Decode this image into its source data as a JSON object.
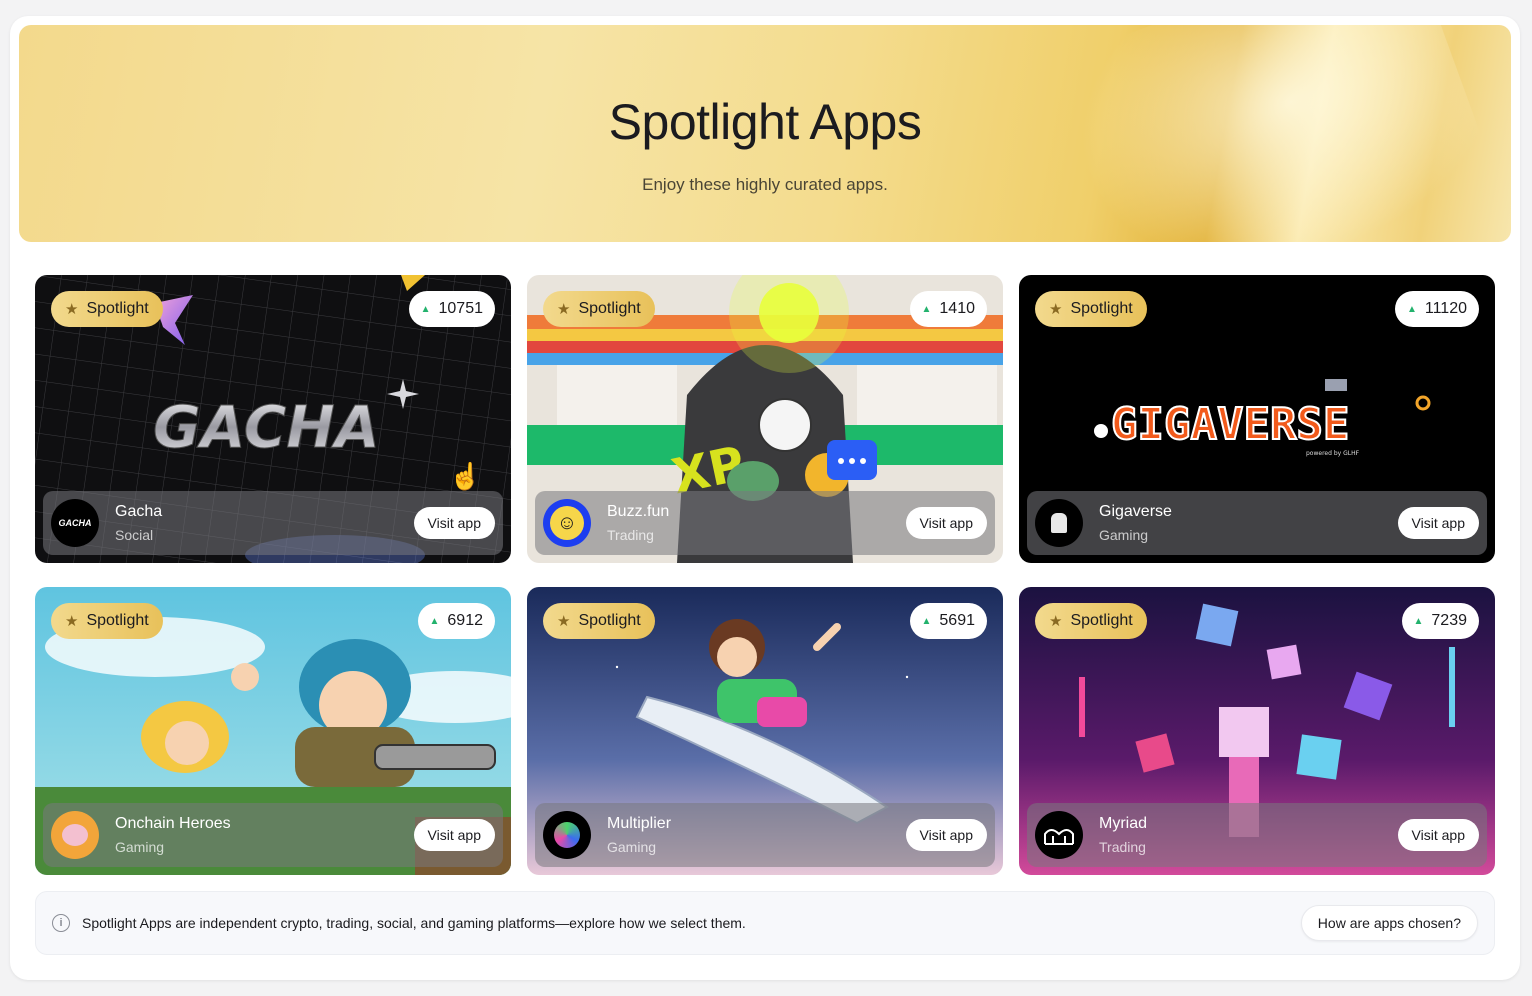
{
  "hero": {
    "title": "Spotlight Apps",
    "subtitle": "Enjoy these highly curated apps."
  },
  "cards": [
    {
      "badge": "Spotlight",
      "count": "10751",
      "name": "Gacha",
      "category": "Social",
      "visit": "Visit app",
      "art_text": "GACHA",
      "logo_text": "GACHA"
    },
    {
      "badge": "Spotlight",
      "count": "1410",
      "name": "Buzz.fun",
      "category": "Trading",
      "visit": "Visit app",
      "art_text": "XP"
    },
    {
      "badge": "Spotlight",
      "count": "11120",
      "name": "Gigaverse",
      "category": "Gaming",
      "visit": "Visit app",
      "art_text": "GIGAVERSE",
      "art_subtext": "powered by GLHF"
    },
    {
      "badge": "Spotlight",
      "count": "6912",
      "name": "Onchain Heroes",
      "category": "Gaming",
      "visit": "Visit app"
    },
    {
      "badge": "Spotlight",
      "count": "5691",
      "name": "Multiplier",
      "category": "Gaming",
      "visit": "Visit app"
    },
    {
      "badge": "Spotlight",
      "count": "7239",
      "name": "Myriad",
      "category": "Trading",
      "visit": "Visit app"
    }
  ],
  "footer": {
    "text": "Spotlight Apps are independent crypto, trading, social, and gaming platforms—explore how we select them.",
    "button": "How are apps chosen?"
  },
  "icons": [
    "star-icon",
    "trend-up-icon",
    "info-icon",
    "cursor-hand-icon"
  ],
  "colors": {
    "badge_gold": "#e8c15a",
    "trend_green": "#23b26d",
    "hero_gold": "#f3d98c"
  }
}
